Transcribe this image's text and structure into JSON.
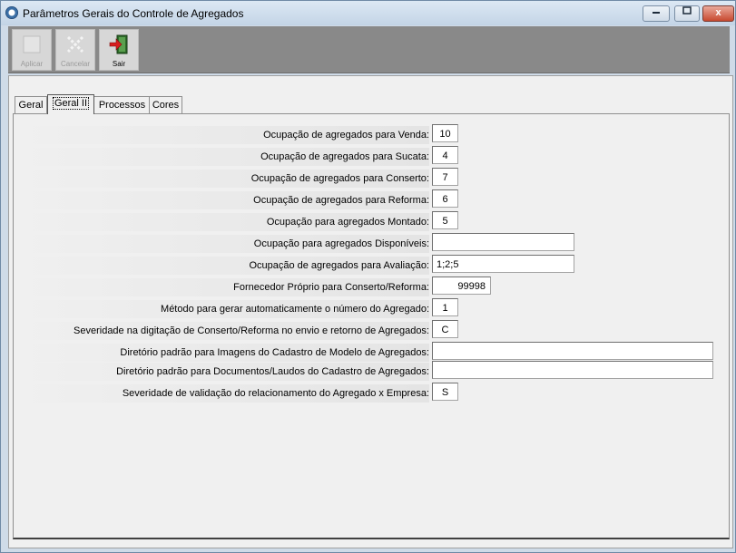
{
  "window": {
    "title": "Parâmetros Gerais do Controle de Agregados",
    "close_glyph": "x"
  },
  "toolbar": {
    "apply_label": "Aplicar",
    "cancel_label": "Cancelar",
    "exit_label": "Sair"
  },
  "tabs": [
    {
      "label": "Geral"
    },
    {
      "label": "Geral II"
    },
    {
      "label": "Processos"
    },
    {
      "label": "Cores"
    }
  ],
  "active_tab": "Geral II",
  "fields": [
    {
      "label": "Ocupação de agregados para Venda:",
      "value": "10"
    },
    {
      "label": "Ocupação de agregados para Sucata:",
      "value": "4"
    },
    {
      "label": "Ocupação de agregados para Conserto:",
      "value": "7"
    },
    {
      "label": "Ocupação de agregados para Reforma:",
      "value": "6"
    },
    {
      "label": "Ocupação para agregados Montado:",
      "value": "5"
    },
    {
      "label": "Ocupação para agregados Disponíveis:",
      "value": ""
    },
    {
      "label": "Ocupação de agregados para Avaliação:",
      "value": "1;2;5"
    },
    {
      "label": "Fornecedor Próprio para Conserto/Reforma:",
      "value": "99998"
    },
    {
      "label": "Método para gerar automaticamente o número do Agregado:",
      "value": "1"
    },
    {
      "label": "Severidade na digitação de Conserto/Reforma no envio e retorno de Agregados:",
      "value": "C"
    },
    {
      "label": "Diretório padrão para Imagens do Cadastro de Modelo de Agregados:",
      "value": ""
    },
    {
      "label": "Diretório padrão para Documentos/Laudos do Cadastro de Agregados:",
      "value": ""
    },
    {
      "label": "Severidade de validação do relacionamento do Agregado x Empresa:",
      "value": "S"
    }
  ]
}
